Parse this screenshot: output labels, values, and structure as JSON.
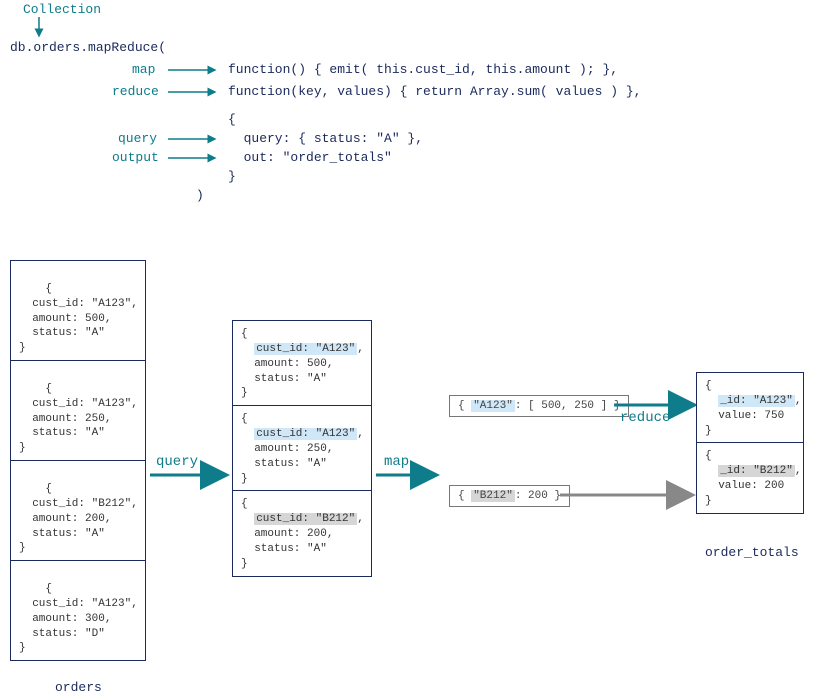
{
  "header": {
    "collection_label": "Collection",
    "line1": "db.orders.mapReduce(",
    "line_map": "function() { emit( this.cust_id, this.amount ); },",
    "line_reduce": "function(key, values) { return Array.sum( values ) },",
    "line_obj_open": "{",
    "line_query": "  query: { status: \"A\" },",
    "line_out": "  out: \"order_totals\"",
    "line_obj_close": "}",
    "line_close": ")",
    "annot_map": "map",
    "annot_reduce": "reduce",
    "annot_query": "query",
    "annot_output": "output"
  },
  "orders": {
    "caption": "orders",
    "docs": [
      {
        "open": "{",
        "l1": "  cust_id: \"A123\",",
        "l2": "  amount: 500,",
        "l3": "  status: \"A\"",
        "close": "}"
      },
      {
        "open": "{",
        "l1": "  cust_id: \"A123\",",
        "l2": "  amount: 250,",
        "l3": "  status: \"A\"",
        "close": "}"
      },
      {
        "open": "{",
        "l1": "  cust_id: \"B212\",",
        "l2": "  amount: 200,",
        "l3": "  status: \"A\"",
        "close": "}"
      },
      {
        "open": "{",
        "l1": "  cust_id: \"A123\",",
        "l2": "  amount: 300,",
        "l3": "  status: \"D\"",
        "close": "}"
      }
    ]
  },
  "filtered": {
    "docs": [
      {
        "open": "{",
        "hl": "cust_id: \"A123\"",
        "comma": ",",
        "l2": "  amount: 500,",
        "l3": "  status: \"A\"",
        "close": "}",
        "hlclass": "hl-blue"
      },
      {
        "open": "{",
        "hl": "cust_id: \"A123\"",
        "comma": ",",
        "l2": "  amount: 250,",
        "l3": "  status: \"A\"",
        "close": "}",
        "hlclass": "hl-blue"
      },
      {
        "open": "{",
        "hl": "cust_id: \"B212\"",
        "comma": ",",
        "l2": "  amount: 200,",
        "l3": "  status: \"A\"",
        "close": "}",
        "hlclass": "hl-gray"
      }
    ]
  },
  "mapped": {
    "a_open": "{ ",
    "a_key": "\"A123\"",
    "a_rest": ": [ 500, 250 ] }",
    "b_open": "{ ",
    "b_key": "\"B212\"",
    "b_rest": ": 200 }"
  },
  "stage": {
    "query": "query",
    "map": "map",
    "reduce": "reduce"
  },
  "result": {
    "caption": "order_totals",
    "docs": [
      {
        "open": "{",
        "hl": "_id: \"A123\"",
        "comma": ",",
        "l2": "  value: 750",
        "close": "}",
        "hlclass": "hl-blue"
      },
      {
        "open": "{",
        "hl": "_id: \"B212\"",
        "comma": ",",
        "l2": "  value: 200",
        "close": "}",
        "hlclass": "hl-gray"
      }
    ]
  }
}
